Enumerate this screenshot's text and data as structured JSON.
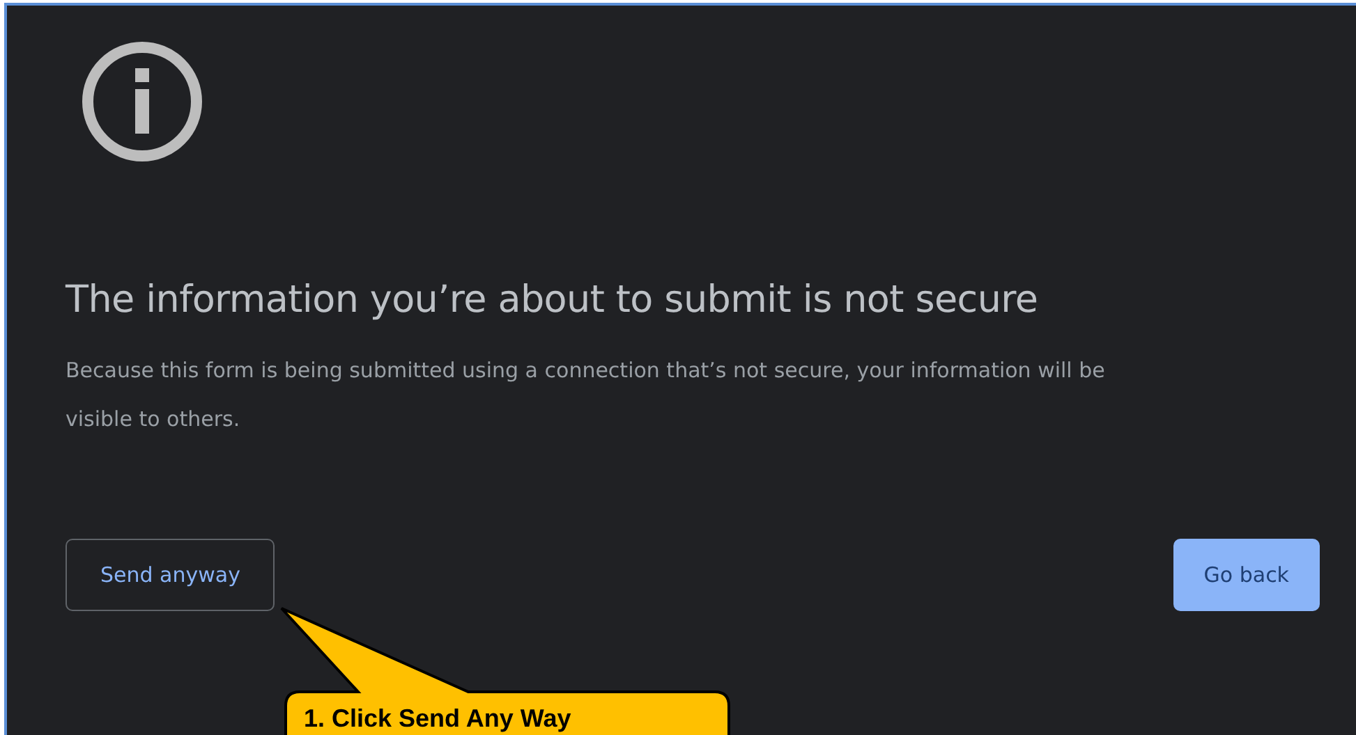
{
  "dialog": {
    "title": "The information you’re about to submit is not secure",
    "message": "Because this form is being submitted using a connection that’s not secure, your information will be visible to others.",
    "buttons": [
      {
        "label": "Send anyway",
        "kind": "secondary"
      },
      {
        "label": "Go back",
        "kind": "primary"
      }
    ]
  },
  "callout": {
    "text": "1. Click  Send Any Way"
  }
}
